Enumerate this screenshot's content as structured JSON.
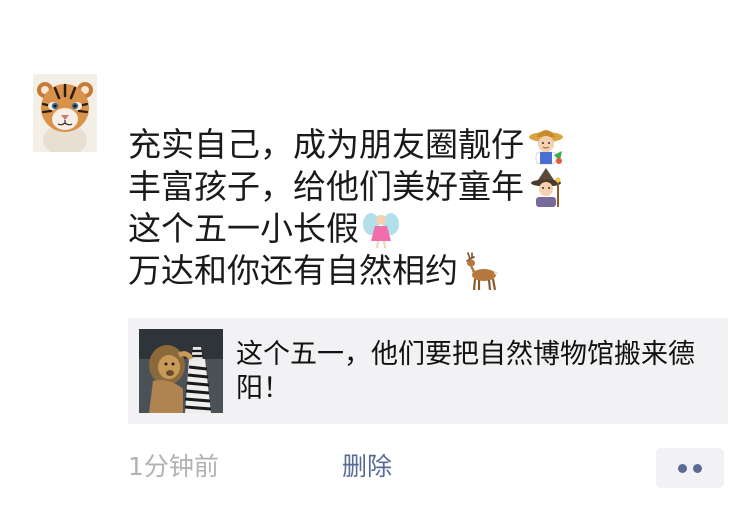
{
  "post": {
    "lines": [
      "充实自己，成为朋友圈靓仔",
      "丰富孩子，给他们美好童年",
      "这个五一小长假",
      "万达和你还有自然相约"
    ],
    "emojis": [
      "farmer-emoji",
      "mage-emoji",
      "fairy-emoji",
      "deer-emoji"
    ]
  },
  "link_card": {
    "title": "这个五一，他们要把自然博物馆搬来德阳！"
  },
  "footer": {
    "time": "1分钟前",
    "delete_label": "删除"
  },
  "avatar": {
    "icon": "tiger-cub-avatar"
  },
  "colors": {
    "link_blue": "#576b95",
    "muted_gray": "#b2b2b2",
    "card_bg": "#f2f2f4"
  }
}
